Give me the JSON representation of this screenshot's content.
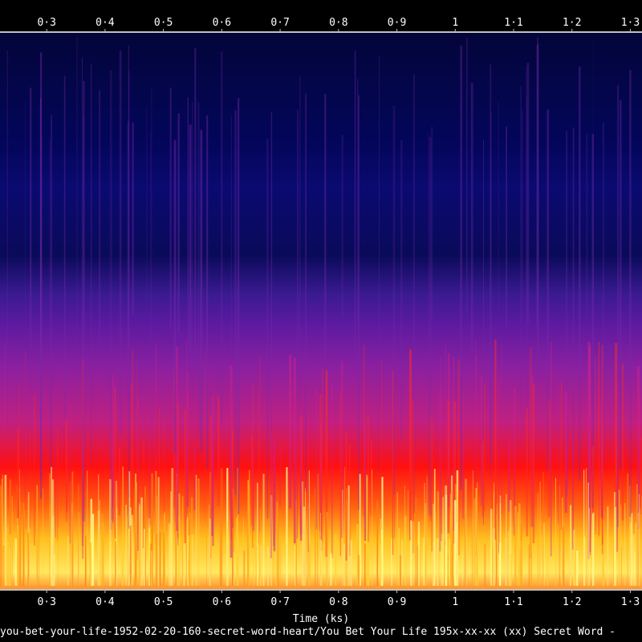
{
  "chart_data": {
    "type": "heatmap",
    "subtype": "spectrogram",
    "xlabel": "Time (ks)",
    "caption": "you-bet-your-life-1952-02-20-160-secret-word-heart/You Bet Your Life 195x-xx-xx (xx) Secret Word - ",
    "x_ticks": [
      {
        "value": 0.3,
        "label": "0·3"
      },
      {
        "value": 0.4,
        "label": "0·4"
      },
      {
        "value": 0.5,
        "label": "0·5"
      },
      {
        "value": 0.6,
        "label": "0·6"
      },
      {
        "value": 0.7,
        "label": "0·7"
      },
      {
        "value": 0.8,
        "label": "0·8"
      },
      {
        "value": 0.9,
        "label": "0·9"
      },
      {
        "value": 1.0,
        "label": "1"
      },
      {
        "value": 1.1,
        "label": "1·1"
      },
      {
        "value": 1.2,
        "label": "1·2"
      },
      {
        "value": 1.3,
        "label": "1·3"
      }
    ],
    "xlim": [
      0.22,
      1.32
    ],
    "tick_labels_top": true,
    "tick_labels_bottom": true,
    "grid": false,
    "colormap": [
      "#000000",
      "#03034a",
      "#1a0a7a",
      "#6a10a0",
      "#b020a0",
      "#e02040",
      "#ff2010",
      "#ff8000",
      "#ffd020",
      "#ffff80"
    ],
    "intensity_profile_by_height": [
      0.05,
      0.12,
      0.22,
      0.3,
      0.48,
      0.62,
      0.78,
      0.92
    ]
  }
}
